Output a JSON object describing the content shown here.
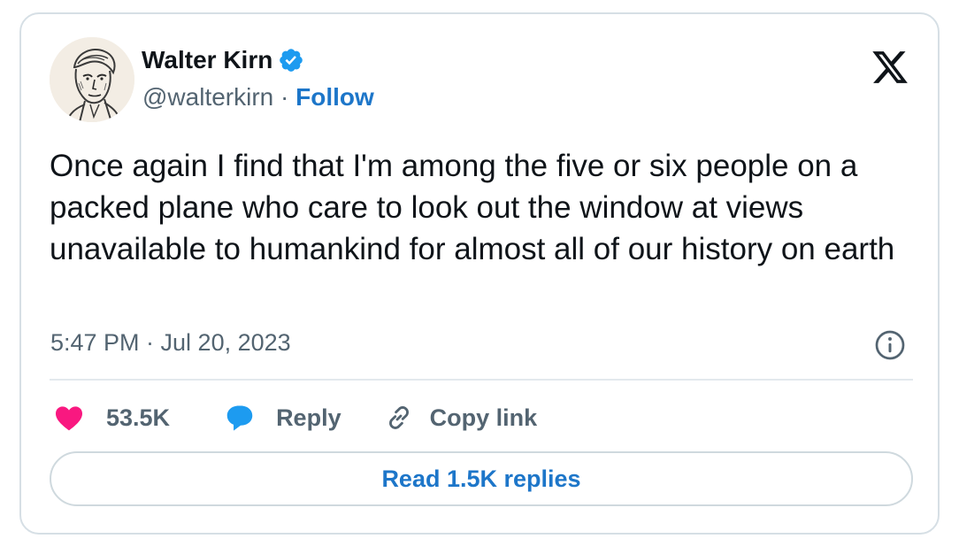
{
  "author": {
    "name": "Walter Kirn",
    "handle": "@walterkirn",
    "separator": "·",
    "follow_label": "Follow",
    "verified": true
  },
  "tweet": {
    "text": "Once again I find that I'm among the five or six people on a packed plane who care to look out the window at views unavailable to humankind for almost all of our history on earth",
    "timestamp": "5:47 PM · Jul 20, 2023"
  },
  "actions": {
    "like_count": "53.5K",
    "reply_label": "Reply",
    "copy_link_label": "Copy link"
  },
  "read_replies_label": "Read 1.5K replies",
  "icons": {
    "avatar": "avatar-sketch",
    "verified": "verified-badge-icon",
    "brand": "x-logo-icon",
    "info": "info-icon",
    "like": "heart-icon",
    "reply": "speech-bubble-icon",
    "copy": "link-icon"
  },
  "colors": {
    "accent": "#1d76c9",
    "like": "#f91880",
    "reply": "#1d9bf0",
    "muted_text": "#536471",
    "text": "#0f1419",
    "border": "#d6dfe5"
  }
}
